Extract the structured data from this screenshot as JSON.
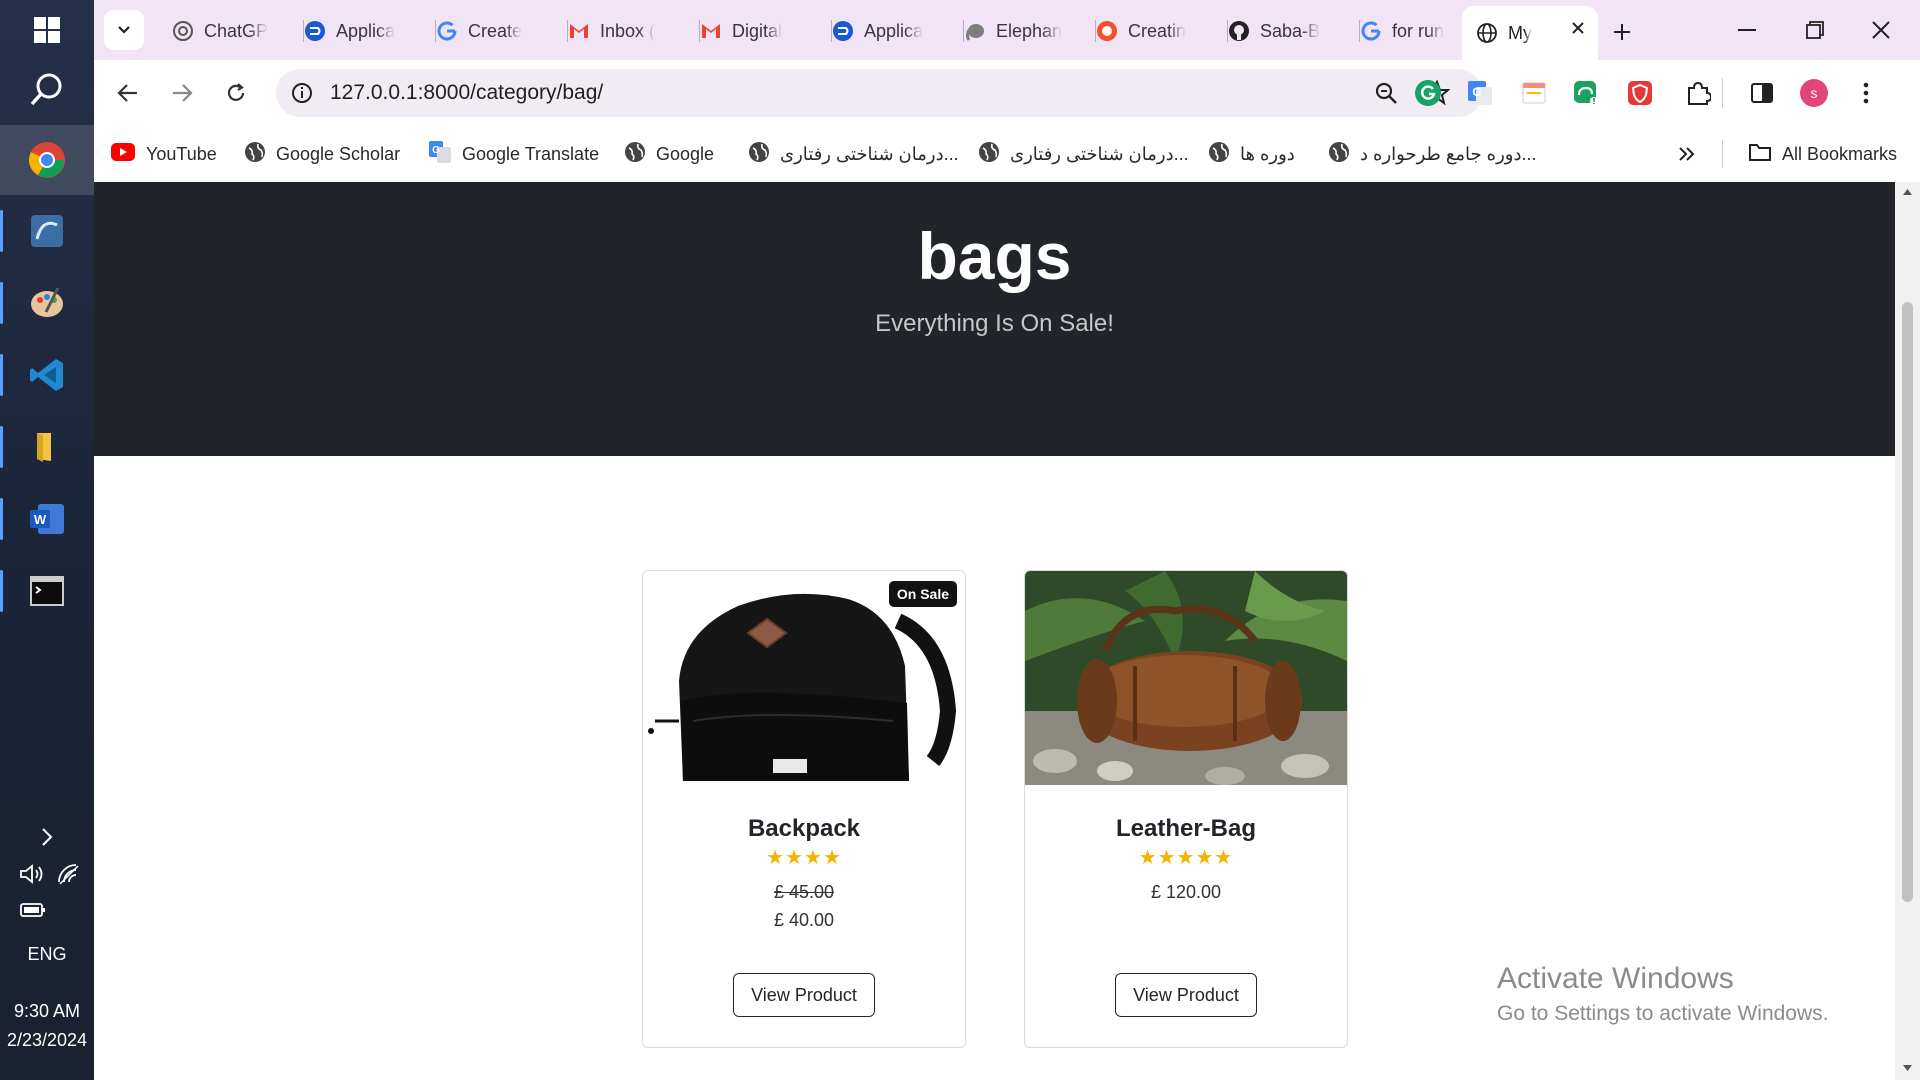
{
  "taskbar": {
    "apps": [
      {
        "name": "windows-start"
      },
      {
        "name": "search"
      },
      {
        "name": "chrome"
      },
      {
        "name": "mysql-workbench"
      },
      {
        "name": "paint"
      },
      {
        "name": "vscode"
      },
      {
        "name": "file-explorer"
      },
      {
        "name": "word"
      },
      {
        "name": "terminal"
      }
    ],
    "language": "ENG",
    "time": "9:30 AM",
    "date": "2/23/2024"
  },
  "tabs": [
    {
      "title": "ChatGP",
      "icon": "chatgpt-icon"
    },
    {
      "title": "Applica",
      "icon": "app-icon"
    },
    {
      "title": "Create",
      "icon": "google-icon"
    },
    {
      "title": "Inbox (",
      "icon": "gmail-icon"
    },
    {
      "title": "Digital",
      "icon": "gmail-icon"
    },
    {
      "title": "Applica",
      "icon": "app-icon"
    },
    {
      "title": "Elephan",
      "icon": "elephant-icon"
    },
    {
      "title": "Creatin",
      "icon": "record-icon"
    },
    {
      "title": "Saba-B",
      "icon": "github-icon"
    },
    {
      "title": "for run",
      "icon": "google-icon"
    },
    {
      "title": "My",
      "icon": "globe-icon",
      "active": true
    }
  ],
  "omnibox": {
    "url": "127.0.0.1:8000/category/bag/"
  },
  "bookmarks": [
    {
      "label": "YouTube",
      "icon": "youtube-icon"
    },
    {
      "label": "Google Scholar",
      "icon": "globe-icon"
    },
    {
      "label": "Google Translate",
      "icon": "translate-icon"
    },
    {
      "label": "Google",
      "icon": "globe-icon"
    },
    {
      "label": "درمان شناختی رفتاری...",
      "icon": "globe-icon"
    },
    {
      "label": "درمان شناختی رفتاری...",
      "icon": "globe-icon"
    },
    {
      "label": "دوره ها",
      "icon": "globe-icon"
    },
    {
      "label": "دوره جامع طرحواره د...",
      "icon": "globe-icon"
    }
  ],
  "all_bookmarks": "All Bookmarks",
  "page": {
    "title": "bags",
    "subtitle": "Everything Is On Sale!",
    "products": [
      {
        "name": "Backpack",
        "badge": "On Sale",
        "rating": 4,
        "old_price": "£ 45.00",
        "price": "£ 40.00",
        "button": "View Product",
        "image": "black-backpack"
      },
      {
        "name": "Leather-Bag",
        "rating": 5,
        "price": "£ 120.00",
        "button": "View Product",
        "image": "brown-leather-duffel-bag"
      }
    ]
  },
  "watermark": {
    "title": "Activate Windows",
    "subtitle": "Go to Settings to activate Windows."
  },
  "colors": {
    "hero_bg": "#212529",
    "star": "#f5b300",
    "tabstrip": "#f0e4f5",
    "profile": "#e0457b"
  }
}
